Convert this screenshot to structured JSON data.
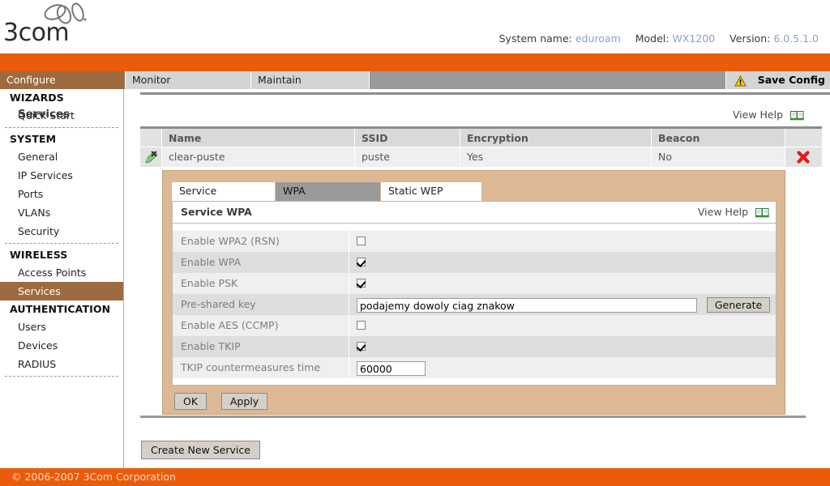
{
  "brand": {
    "logo_text": "3com",
    "logo_mark": "3com-swirl-logo"
  },
  "header": {
    "system_name_label": "System name:",
    "system_name_value": "eduroam",
    "model_label": "Model:",
    "model_value": "WX1200",
    "version_label": "Version:",
    "version_value": "6.0.5.1.0"
  },
  "mainnav": {
    "tabs": [
      {
        "label": "Configure",
        "active": true
      },
      {
        "label": "Monitor",
        "active": false
      },
      {
        "label": "Maintain",
        "active": false
      }
    ],
    "save_config": "Save Config",
    "save_config_icon": "warning-triangle-icon"
  },
  "sidebar": {
    "groups": [
      {
        "title": "WIZARDS",
        "items": [
          {
            "label": "Quick Start",
            "active": false
          }
        ]
      },
      {
        "title": "SYSTEM",
        "items": [
          {
            "label": "General",
            "active": false
          },
          {
            "label": "IP Services",
            "active": false
          },
          {
            "label": "Ports",
            "active": false
          },
          {
            "label": "VLANs",
            "active": false
          },
          {
            "label": "Security",
            "active": false
          }
        ]
      },
      {
        "title": "WIRELESS",
        "items": [
          {
            "label": "Access Points",
            "active": false
          },
          {
            "label": "Services",
            "active": true
          }
        ]
      },
      {
        "title": "AUTHENTICATION",
        "items": [
          {
            "label": "Users",
            "active": false
          },
          {
            "label": "Devices",
            "active": false
          },
          {
            "label": "RADIUS",
            "active": false
          }
        ]
      }
    ]
  },
  "main": {
    "page_title": "Services",
    "view_help": "View Help",
    "view_help_icon": "open-book-icon",
    "table": {
      "columns": [
        "",
        "Name",
        "SSID",
        "Encryption",
        "Beacon",
        ""
      ],
      "rows": [
        {
          "edit_icon": "edit-pencil-icon",
          "name": "clear-puste",
          "ssid": "puste",
          "encryption": "Yes",
          "beacon": "No",
          "delete_icon": "delete-x-icon"
        }
      ]
    },
    "detail": {
      "tabs": [
        {
          "label": "Service",
          "active": false
        },
        {
          "label": "WPA",
          "active": true
        },
        {
          "label": "Static WEP",
          "active": false
        }
      ],
      "panel_title": "Service WPA",
      "panel_help": "View Help",
      "panel_help_icon": "open-book-icon",
      "fields": [
        {
          "label": "Enable WPA2 (RSN)",
          "type": "checkbox",
          "checked": false
        },
        {
          "label": "Enable WPA",
          "type": "checkbox",
          "checked": true
        },
        {
          "label": "Enable PSK",
          "type": "checkbox",
          "checked": true
        },
        {
          "label": "Pre-shared key",
          "type": "text",
          "value": "podajemy dowoly ciag znakow",
          "button": "Generate"
        },
        {
          "label": "Enable AES (CCMP)",
          "type": "checkbox",
          "checked": false
        },
        {
          "label": "Enable TKIP",
          "type": "checkbox",
          "checked": true
        },
        {
          "label": "TKIP countermeasures time",
          "type": "text",
          "value": "60000"
        }
      ],
      "ok_label": "OK",
      "apply_label": "Apply"
    },
    "create_button": "Create New Service"
  },
  "footer": {
    "copyright": "© 2006-2007 3Com Corporation"
  },
  "colors": {
    "brand_orange": "#ea5b0c",
    "active_brown": "#9d6b3f",
    "panel_tan": "#ddb894",
    "nav_gray": "#9a9a9a",
    "value_blue": "#8f9fc4"
  }
}
